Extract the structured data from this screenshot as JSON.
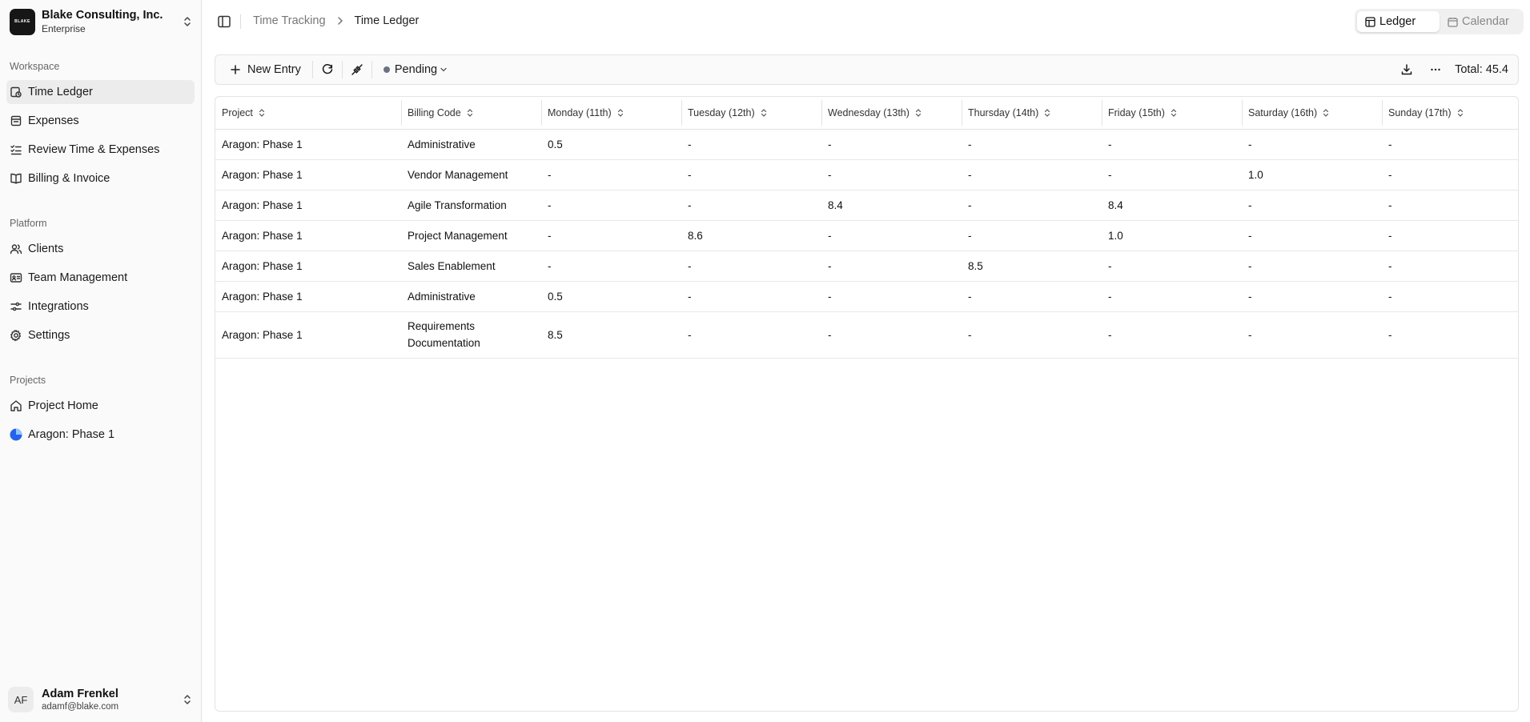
{
  "org": {
    "name": "Blake Consulting, Inc.",
    "plan": "Enterprise",
    "logo_text": "BLAKE"
  },
  "sidebar": {
    "workspace_label": "Workspace",
    "workspace_items": [
      {
        "label": "Time Ledger",
        "icon": "clock-ledger-icon",
        "active": true
      },
      {
        "label": "Expenses",
        "icon": "receipt-icon"
      },
      {
        "label": "Review Time & Expenses",
        "icon": "checklist-icon"
      },
      {
        "label": "Billing & Invoice",
        "icon": "book-icon"
      }
    ],
    "platform_label": "Platform",
    "platform_items": [
      {
        "label": "Clients",
        "icon": "users-icon"
      },
      {
        "label": "Team Management",
        "icon": "id-card-icon"
      },
      {
        "label": "Integrations",
        "icon": "sliders-icon"
      },
      {
        "label": "Settings",
        "icon": "gear-icon"
      }
    ],
    "projects_label": "Projects",
    "project_items": [
      {
        "label": "Project Home",
        "icon": "home-icon"
      },
      {
        "label": "Aragon: Phase 1",
        "icon": "project-dot-icon"
      }
    ]
  },
  "user": {
    "initials": "AF",
    "name": "Adam Frenkel",
    "email": "adamf@blake.com"
  },
  "header": {
    "breadcrumb": [
      "Time Tracking",
      "Time Ledger"
    ],
    "views": [
      {
        "label": "Ledger",
        "active": true
      },
      {
        "label": "Calendar",
        "active": false
      }
    ]
  },
  "toolbar": {
    "new_entry": "New Entry",
    "status": "Pending",
    "total": "Total: 45.4"
  },
  "table": {
    "columns": [
      "Project",
      "Billing Code",
      "Monday (11th)",
      "Tuesday (12th)",
      "Wednesday (13th)",
      "Thursday (14th)",
      "Friday (15th)",
      "Saturday (16th)",
      "Sunday (17th)"
    ],
    "rows": [
      [
        "Aragon: Phase 1",
        "Administrative",
        "0.5",
        "-",
        "-",
        "-",
        "-",
        "-",
        "-"
      ],
      [
        "Aragon: Phase 1",
        "Vendor Management",
        "-",
        "-",
        "-",
        "-",
        "-",
        "1.0",
        "-"
      ],
      [
        "Aragon: Phase 1",
        "Agile Transformation",
        "-",
        "-",
        "8.4",
        "-",
        "8.4",
        "-",
        "-"
      ],
      [
        "Aragon: Phase 1",
        "Project Management",
        "-",
        "8.6",
        "-",
        "-",
        "1.0",
        "-",
        "-"
      ],
      [
        "Aragon: Phase 1",
        "Sales Enablement",
        "-",
        "-",
        "-",
        "8.5",
        "-",
        "-",
        "-"
      ],
      [
        "Aragon: Phase 1",
        "Administrative",
        "0.5",
        "-",
        "-",
        "-",
        "-",
        "-",
        "-"
      ],
      [
        "Aragon: Phase 1",
        "Requirements Documentation",
        "8.5",
        "-",
        "-",
        "-",
        "-",
        "-",
        "-"
      ]
    ]
  }
}
